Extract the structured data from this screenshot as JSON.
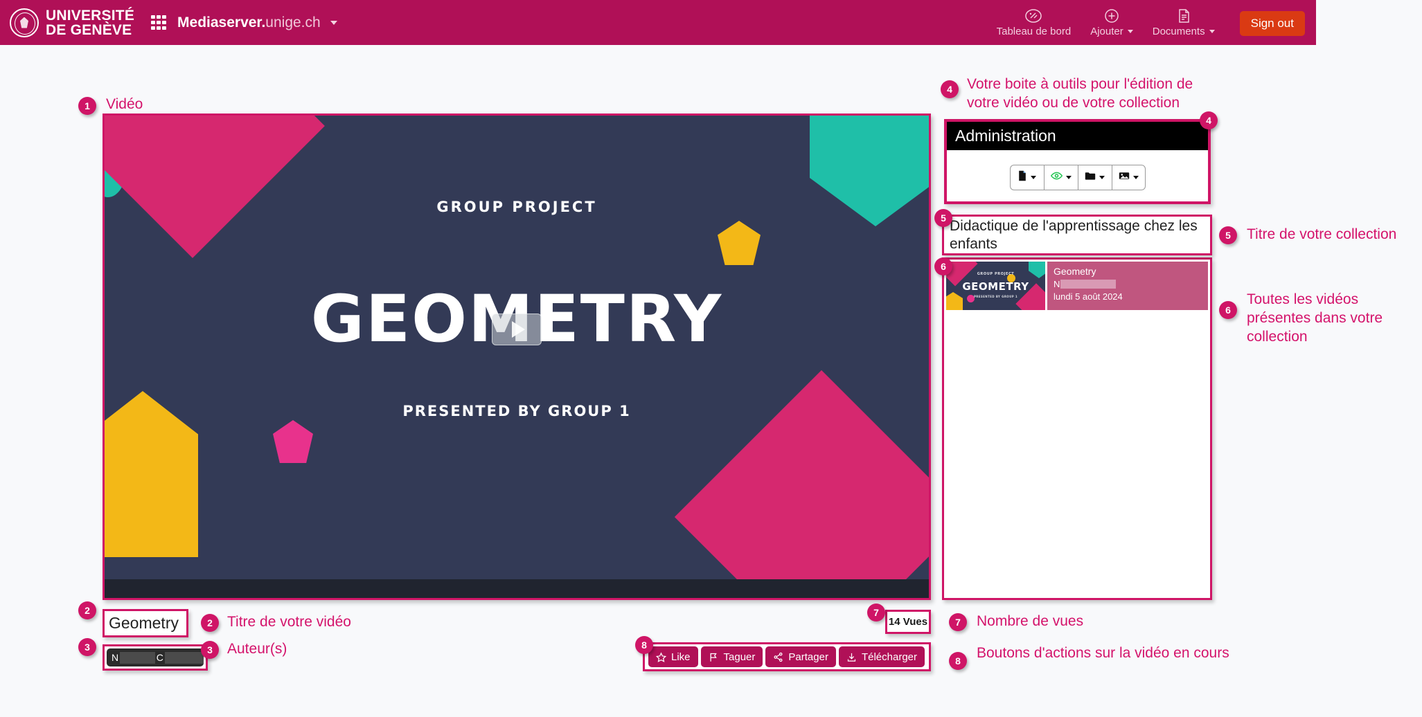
{
  "header": {
    "university_line1": "UNIVERSITÉ",
    "university_line2": "DE GENÈVE",
    "brand_strong": "Mediaserver.",
    "brand_light": "unige.ch",
    "nav": [
      {
        "label": "Tableau de bord",
        "icon": "dashboard-icon",
        "has_caret": false
      },
      {
        "label": "Ajouter",
        "icon": "plus-circle-icon",
        "has_caret": true
      },
      {
        "label": "Documents",
        "icon": "document-list-icon",
        "has_caret": true
      }
    ],
    "signout_label": "Sign out"
  },
  "video": {
    "section_label": "Vidéo",
    "slide": {
      "kicker": "GROUP PROJECT",
      "title": "GEOMETRY",
      "subtitle": "PRESENTED BY GROUP 1"
    },
    "title": "Geometry",
    "authors_prefix_1": "N",
    "authors_prefix_2": "C",
    "views": "14 Vues",
    "actions": [
      {
        "label": "Like",
        "icon": "star-icon"
      },
      {
        "label": "Taguer",
        "icon": "flag-icon"
      },
      {
        "label": "Partager",
        "icon": "share-icon"
      },
      {
        "label": "Télécharger",
        "icon": "download-icon"
      }
    ]
  },
  "admin": {
    "title": "Administration",
    "buttons": [
      {
        "icon": "file-icon",
        "label": ""
      },
      {
        "icon": "eye-icon",
        "label": ""
      },
      {
        "icon": "folder-icon",
        "label": ""
      },
      {
        "icon": "image-icon",
        "label": ""
      }
    ]
  },
  "collection": {
    "title": "Didactique de l'apprentissage chez les enfants",
    "videos": [
      {
        "title": "Geometry",
        "author_prefix": "N",
        "date": "lundi 5 août 2024",
        "thumb_kicker": "GROUP PROJECT",
        "thumb_title": "GEOMETRY",
        "thumb_sub": "PRESENTED BY GROUP 1"
      }
    ]
  },
  "annotations": [
    {
      "n": "1",
      "text": ""
    },
    {
      "n": "2",
      "text": "Titre de votre vidéo"
    },
    {
      "n": "3",
      "text": "Auteur(s)"
    },
    {
      "n": "4",
      "text": "Votre boite à outils pour l'édition de votre vidéo ou de votre collection"
    },
    {
      "n": "5",
      "text": "Titre de votre collection"
    },
    {
      "n": "6",
      "text": "Toutes les vidéos présentes dans votre collection"
    },
    {
      "n": "7",
      "text": "Nombre de vues"
    },
    {
      "n": "8",
      "text": "Boutons d'actions sur la vidéo en cours"
    }
  ],
  "colors": {
    "brand_magenta": "#b01057",
    "annotation_pink": "#cf1566",
    "signout_orange": "#da3a13",
    "slide_navy": "#333a56",
    "slide_pink": "#d6286f",
    "slide_teal": "#1fbfa8",
    "slide_yellow": "#f3b817"
  }
}
